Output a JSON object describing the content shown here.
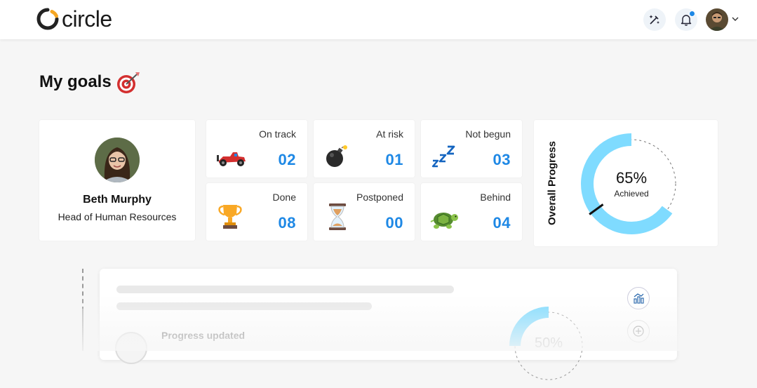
{
  "header": {
    "brand": "circle",
    "icons": [
      "magic-wand-icon",
      "bell-icon",
      "user-avatar",
      "chevron-down-icon"
    ],
    "has_notification": true
  },
  "page": {
    "title": "My goals",
    "title_icon": "target-emoji"
  },
  "profile": {
    "name": "Beth Murphy",
    "role": "Head of Human Resources"
  },
  "stats": [
    {
      "label": "On track",
      "value": "02",
      "icon": "race-car-emoji"
    },
    {
      "label": "At risk",
      "value": "01",
      "icon": "bomb-emoji"
    },
    {
      "label": "Not begun",
      "value": "03",
      "icon": "zzz-emoji"
    },
    {
      "label": "Done",
      "value": "08",
      "icon": "trophy-emoji"
    },
    {
      "label": "Postponed",
      "value": "00",
      "icon": "hourglass-emoji"
    },
    {
      "label": "Behind",
      "value": "04",
      "icon": "turtle-emoji"
    }
  ],
  "overall": {
    "label": "Overall Progress",
    "percent_text": "65%",
    "percent": 65,
    "sub": "Achieved"
  },
  "feed": {
    "event": "Progress updated",
    "percent_text": "50%",
    "percent": 50
  },
  "colors": {
    "accent": "#1e88e5",
    "donut": "#7fdbff"
  }
}
